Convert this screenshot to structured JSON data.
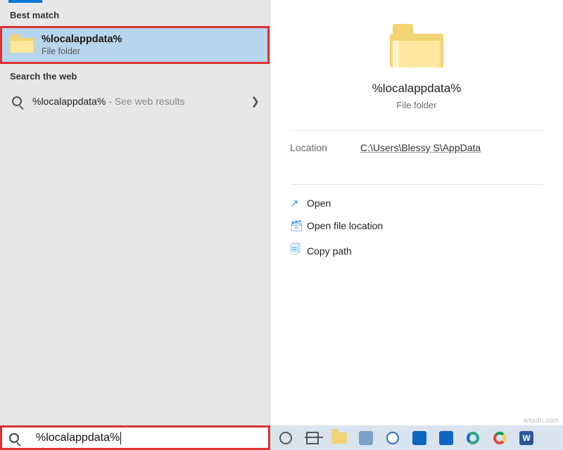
{
  "left": {
    "best_match_header": "Best match",
    "item": {
      "title": "%localappdata%",
      "subtitle": "File folder"
    },
    "web_header": "Search the web",
    "web_item": {
      "label": "%localappdata%",
      "hint": "- See web results"
    }
  },
  "right": {
    "title": "%localappdata%",
    "subtitle": "File folder",
    "location_label": "Location",
    "location_path": "C:\\Users\\Blessy S\\AppData",
    "actions": {
      "open": "Open",
      "open_loc": "Open file location",
      "copy": "Copy path"
    }
  },
  "taskbar": {
    "search_value": "%localappdata%"
  },
  "watermark": "wsxdn.com"
}
